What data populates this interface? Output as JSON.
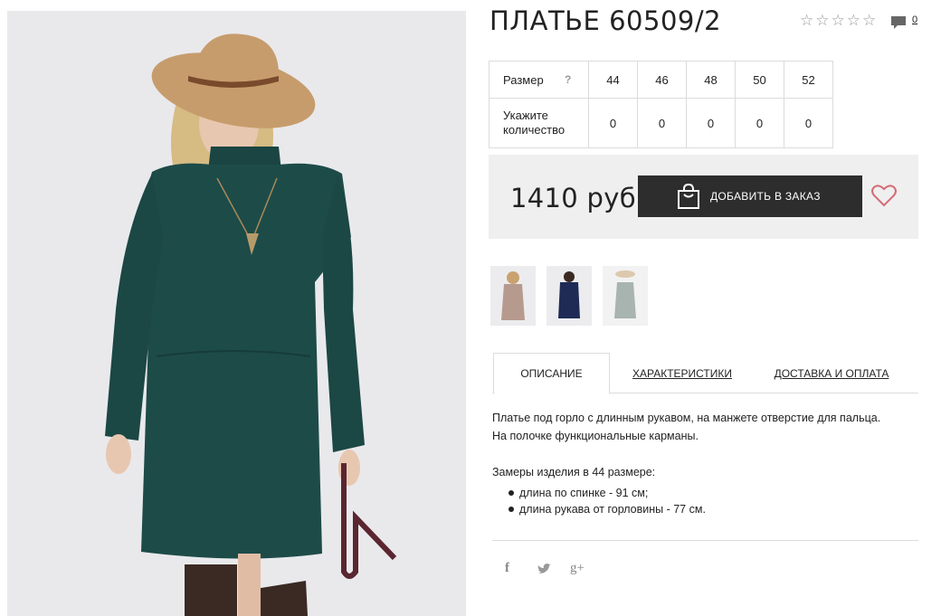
{
  "product": {
    "title": "ПЛАТЬЕ 60509/2",
    "rating_stars": 5,
    "comment_count": "0"
  },
  "size_table": {
    "size_label": "Размер",
    "help": "?",
    "qty_label_line1": "Укажите",
    "qty_label_line2": "количество",
    "sizes": [
      "44",
      "46",
      "48",
      "50",
      "52"
    ],
    "quantities": [
      "0",
      "0",
      "0",
      "0",
      "0"
    ]
  },
  "buy": {
    "price": "1410 руб",
    "add_to_order": "ДОБАВИТЬ В ЗАКАЗ"
  },
  "tabs": {
    "description": "ОПИСАНИЕ",
    "specs": "ХАРАКТЕРИСТИКИ",
    "delivery": "ДОСТАВКА И ОПЛАТА"
  },
  "description": {
    "line1": "Платье под горло с длинным рукавом, на манжете отверстие для пальца.",
    "line2": "На полочке функциональные карманы.",
    "measures_title": "Замеры изделия в 44 размере:",
    "measures": [
      "длина по спинке - 91 см;",
      "длина рукава от горловины - 77 см."
    ]
  },
  "social": {
    "facebook": "f",
    "twitter": "t",
    "gplus": "g+"
  },
  "colors": {
    "dress_main": "#1d4b48",
    "hat": "#c79c6c",
    "button_bg": "#2d2d2d",
    "heart": "#d46b74"
  }
}
